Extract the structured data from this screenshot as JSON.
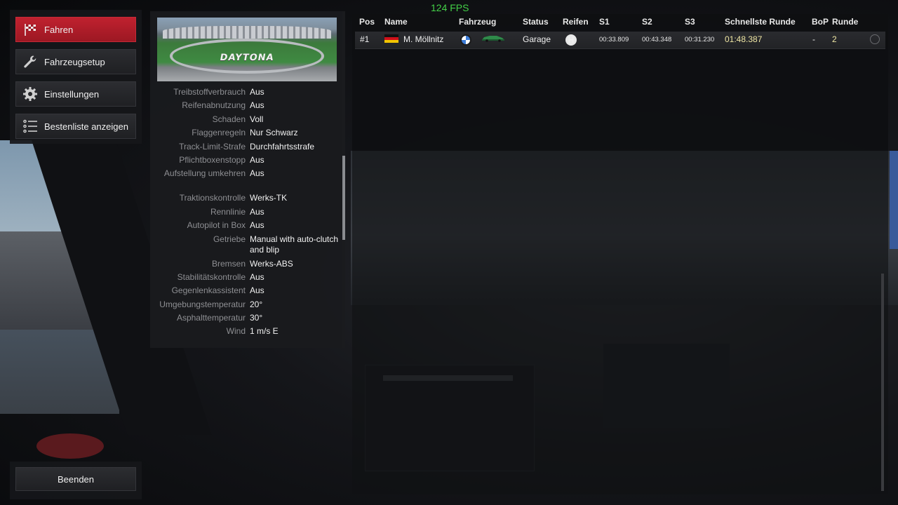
{
  "fps": "124 FPS",
  "menu": {
    "items": [
      {
        "label": "Fahren",
        "icon": "checkered-flag-icon",
        "active": true
      },
      {
        "label": "Fahrzeugsetup",
        "icon": "wrench-icon",
        "active": false
      },
      {
        "label": "Einstellungen",
        "icon": "gear-icon",
        "active": false
      },
      {
        "label": "Bestenliste anzeigen",
        "icon": "list-icon",
        "active": false
      }
    ],
    "quit_label": "Beenden"
  },
  "track": {
    "logo_text": "DAYTONA"
  },
  "settings": [
    {
      "key": "Treibstoffverbrauch",
      "value": "Aus"
    },
    {
      "key": "Reifenabnutzung",
      "value": "Aus"
    },
    {
      "key": "Schaden",
      "value": "Voll"
    },
    {
      "key": "Flaggenregeln",
      "value": "Nur Schwarz"
    },
    {
      "key": "Track-Limit-Strafe",
      "value": "Durchfahrtsstrafe"
    },
    {
      "key": "Pflichtboxenstopp",
      "value": "Aus"
    },
    {
      "key": "Aufstellung umkehren",
      "value": "Aus"
    },
    {
      "key": "Traktionskontrolle",
      "value": "Werks-TK"
    },
    {
      "key": "Rennlinie",
      "value": "Aus"
    },
    {
      "key": "Autopilot in Box",
      "value": "Aus"
    },
    {
      "key": "Getriebe",
      "value": "Manual with auto-clutch and blip"
    },
    {
      "key": "Bremsen",
      "value": "Werks-ABS"
    },
    {
      "key": "Stabilitätskontrolle",
      "value": "Aus"
    },
    {
      "key": "Gegenlenkassistent",
      "value": "Aus"
    },
    {
      "key": "Umgebungstemperatur",
      "value": "20°"
    },
    {
      "key": "Asphalttemperatur",
      "value": "30°"
    },
    {
      "key": "Wind",
      "value": "1 m/s E"
    }
  ],
  "standings": {
    "headers": {
      "pos": "Pos",
      "name": "Name",
      "car": "Fahrzeug",
      "status": "Status",
      "tyres": "Reifen",
      "s1": "S1",
      "s2": "S2",
      "s3": "S3",
      "best": "Schnellste Runde",
      "bop": "BoP",
      "lap": "Runde"
    },
    "rows": [
      {
        "pos": "#1",
        "name": "M. Möllnitz",
        "brand_icon": "bmw-logo-icon",
        "status": "Garage",
        "tyre": "H",
        "s1": "00:33.809",
        "s2": "00:43.348",
        "s3": "00:31.230",
        "best": "01:48.387",
        "bop": "-",
        "lap": "2"
      }
    ]
  },
  "colors": {
    "accent_red": "#b81c2a",
    "fps_green": "#43d047"
  }
}
